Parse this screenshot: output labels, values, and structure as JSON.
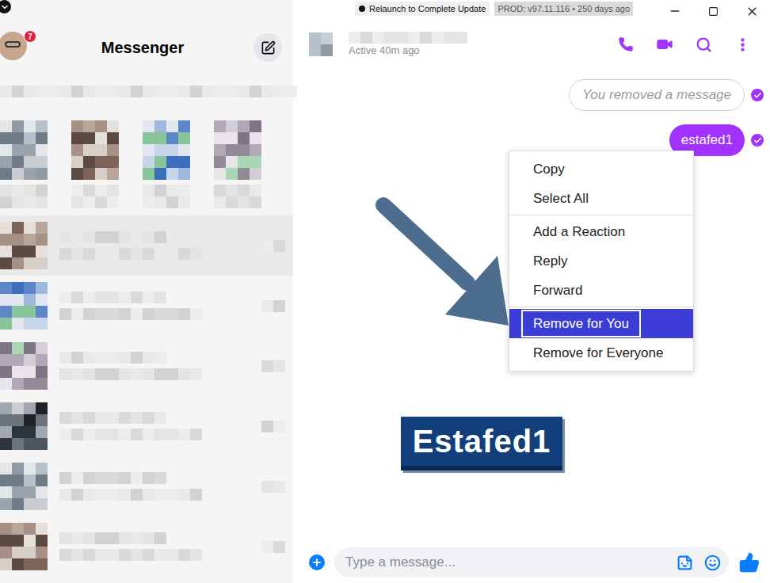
{
  "app": {
    "title": "Messenger",
    "notification_count": "7"
  },
  "update_bar": {
    "notice": "Relaunch to Complete Update",
    "build": "PROD: v97.11.116 • 250 days ago"
  },
  "chat": {
    "status": "Active 40m ago",
    "messages": [
      {
        "kind": "removed",
        "text": "You removed a message",
        "seen": true
      },
      {
        "kind": "text",
        "text": "estafed1",
        "seen": true
      }
    ]
  },
  "context_menu": {
    "groups": [
      [
        {
          "label": "Copy",
          "selected": false
        },
        {
          "label": "Select All",
          "selected": false
        }
      ],
      [
        {
          "label": "Add a Reaction",
          "selected": false
        },
        {
          "label": "Reply",
          "selected": false
        },
        {
          "label": "Forward",
          "selected": false
        }
      ],
      [
        {
          "label": "Remove for You",
          "selected": true
        },
        {
          "label": "Remove for Everyone",
          "selected": false
        }
      ]
    ]
  },
  "composer": {
    "placeholder": "Type a message..."
  },
  "watermark": {
    "text": "Estafed1"
  }
}
